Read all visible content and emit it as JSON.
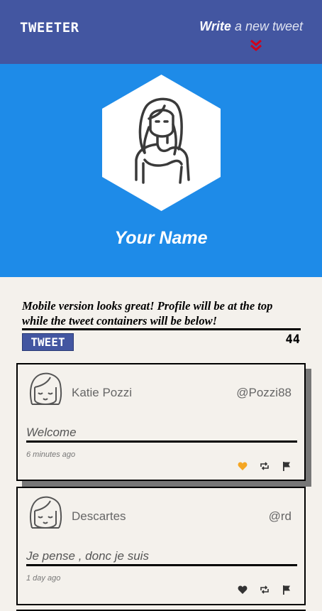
{
  "header": {
    "logo": "TWEETER",
    "write_bold": "Write",
    "write_rest": " a new tweet",
    "chevron_icon": "double-chevron-down-icon",
    "accent": "#4356a1"
  },
  "profile": {
    "name": "Your Name",
    "background": "#1e8be8"
  },
  "compose": {
    "text": "Mobile version looks great! Profile will be at the top while the tweet containers will be below!",
    "button_label": "TWEET",
    "char_count": "44"
  },
  "tweets": [
    {
      "name": "Katie Pozzi",
      "handle": "@Pozzi88",
      "text": "Welcome",
      "time": "6 minutes ago",
      "liked": true,
      "like_color": "#f5a623"
    },
    {
      "name": "Descartes",
      "handle": "@rd",
      "text": "Je pense , donc je suis",
      "time": "1 day ago",
      "liked": false,
      "like_color": "#333333"
    }
  ]
}
